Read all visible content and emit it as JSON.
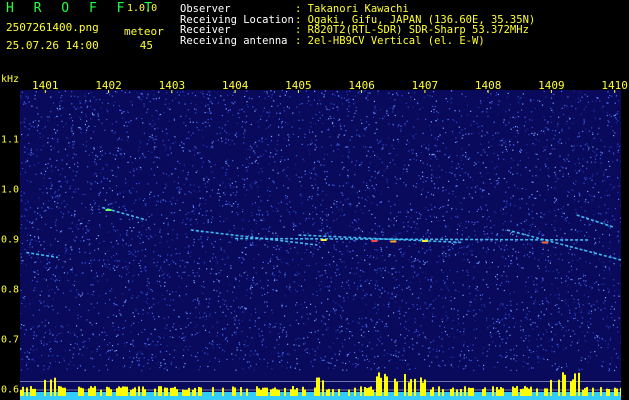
{
  "header": {
    "logo": "HROFFT",
    "version": "1.0.0",
    "filename": "2507261400.png",
    "datetime": "25.07.26 14:00",
    "meteor_label": "meteor",
    "meteor_count": "45",
    "fields": [
      {
        "label": "Observer",
        "value": ": Takanori Kawachi"
      },
      {
        "label": "Receiving Location",
        "value": ": Ogaki, Gifu, JAPAN (136.60E, 35.35N)"
      },
      {
        "label": "Receiver",
        "value": ": R820T2(RTL-SDR) SDR-Sharp 53.372MHz"
      },
      {
        "label": "Receiving antenna",
        "value": ": 2el-HB9CV Vertical (el. E-W)"
      }
    ]
  },
  "colors": {
    "background": "#0a0a5c",
    "text": "#ffff33",
    "logo": "#22ff44",
    "baseline": "#33ccff",
    "histogram": "#ffff00"
  },
  "chart_data": {
    "type": "heatmap",
    "yunit": "kHz",
    "x_ticks": [
      "1401",
      "1402",
      "1403",
      "1404",
      "1405",
      "1406",
      "1407",
      "1408",
      "1409",
      "1410"
    ],
    "y_ticks": [
      "1.1",
      "1.0",
      "0.9",
      "0.8",
      "0.7",
      "0.6"
    ],
    "xlim": [
      1400.6,
      1410.1
    ],
    "ylim": [
      0.58,
      1.2
    ],
    "traces": [
      {
        "x": [
          1400.7,
          1401.2
        ],
        "y": [
          0.875,
          0.865
        ]
      },
      {
        "x": [
          1401.9,
          1402.6
        ],
        "y": [
          0.965,
          0.94
        ]
      },
      {
        "x": [
          1403.3,
          1405.3
        ],
        "y": [
          0.92,
          0.89
        ]
      },
      {
        "x": [
          1405.0,
          1407.6
        ],
        "y": [
          0.91,
          0.895
        ]
      },
      {
        "x": [
          1404.0,
          1409.6
        ],
        "y": [
          0.903,
          0.9
        ]
      },
      {
        "x": [
          1408.3,
          1410.1
        ],
        "y": [
          0.92,
          0.86
        ]
      },
      {
        "x": [
          1409.4,
          1410.0
        ],
        "y": [
          0.95,
          0.925
        ]
      }
    ]
  }
}
